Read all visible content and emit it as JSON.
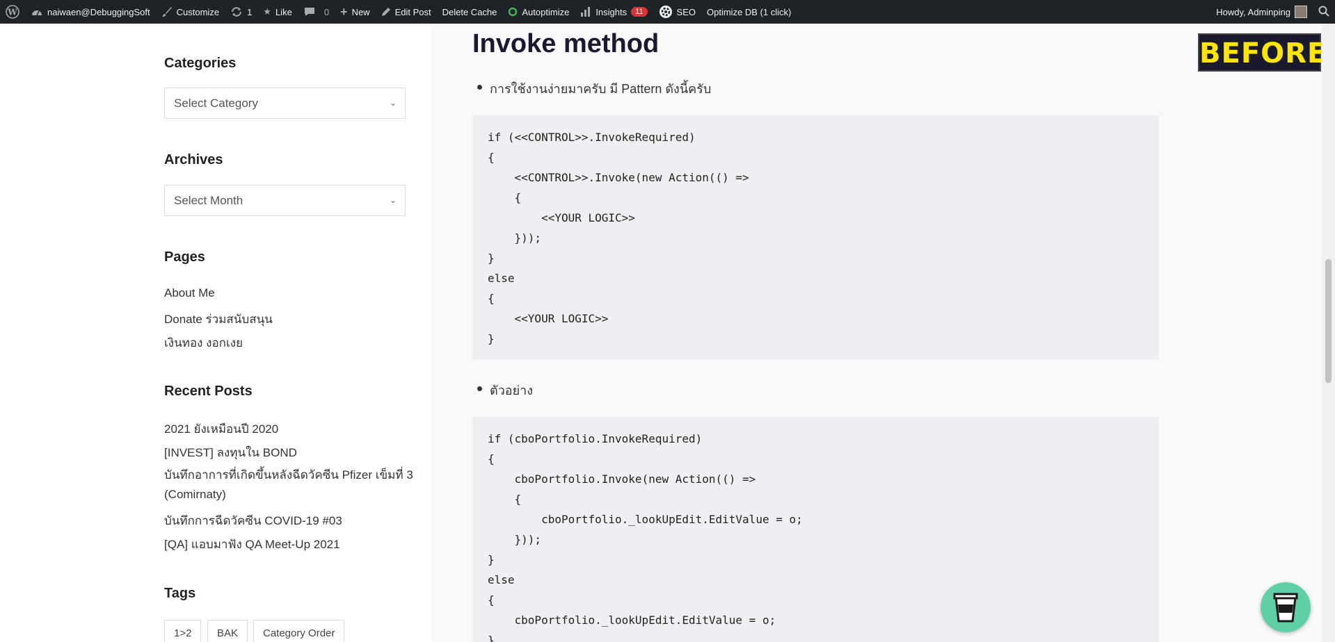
{
  "adminbar": {
    "site_name": "naiwaen@DebuggingSoft",
    "customize": "Customize",
    "updates_count": "1",
    "like": "Like",
    "comments_count": "0",
    "new": "New",
    "edit_post": "Edit Post",
    "delete_cache": "Delete Cache",
    "autoptimize": "Autoptimize",
    "insights": "Insights",
    "insights_badge": "11",
    "seo": "SEO",
    "optimize_db": "Optimize DB (1 click)",
    "howdy": "Howdy, Adminping"
  },
  "sidebar": {
    "categories_title": "Categories",
    "categories_select": "Select Category",
    "archives_title": "Archives",
    "archives_select": "Select Month",
    "pages_title": "Pages",
    "pages": [
      "About Me",
      "Donate ร่วมสนับสนุน",
      "เงินทอง งอกเงย"
    ],
    "recent_title": "Recent Posts",
    "recent": [
      "2021 ยังเหมือนปี 2020",
      "[INVEST] ลงทุนใน BOND",
      "บันทึกอาการที่เกิดขึ้นหลังฉีดวัคซีน Pfizer เข็มที่ 3 (Comirnaty)",
      "บันทึกการฉีดวัคซีน COVID-19 #03",
      "[QA] แอบมาฟัง QA Meet-Up 2021"
    ],
    "tags_title": "Tags",
    "tags": [
      "1>2",
      "BAK",
      "Category Order"
    ]
  },
  "main": {
    "heading": "Invoke method",
    "bullet1": "การใช้งานง่ายมาครับ มี Pattern ดังนี้ครับ",
    "code1": [
      "if (<<CONTROL>>.InvokeRequired)",
      "{",
      "    <<CONTROL>>.Invoke(new Action(() =>",
      "    {",
      "        <<YOUR LOGIC>>",
      "    }));",
      "}",
      "else",
      "{",
      "    <<YOUR LOGIC>>",
      "}"
    ],
    "bullet2": "ตัวอย่าง",
    "code2": [
      "if (cboPortfolio.InvokeRequired)",
      "{",
      "    cboPortfolio.Invoke(new Action(() =>",
      "    {",
      "        cboPortfolio._lookUpEdit.EditValue = o;",
      "    }));",
      "}",
      "else",
      "{",
      "    cboPortfolio._lookUpEdit.EditValue = o;",
      "}"
    ],
    "before_badge": "BEFORE"
  }
}
